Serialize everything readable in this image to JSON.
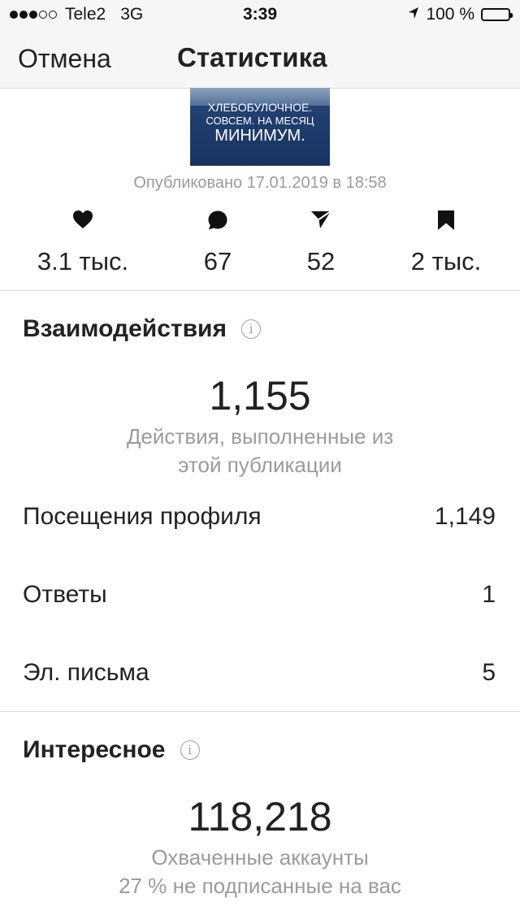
{
  "status_bar": {
    "carrier": "Tele2",
    "network": "3G",
    "time": "3:39",
    "battery": "100 %",
    "signal_bars_filled": 3,
    "signal_bars_total": 5
  },
  "nav": {
    "cancel_label": "Отмена",
    "title": "Статистика"
  },
  "post": {
    "caption_lines": [
      "ХЛЕБОБУЛОЧНОЕ.",
      "СОВСЕМ. НА МЕСЯЦ",
      "МИНИМУМ."
    ],
    "published": "Опубликовано 17.01.2019 в 18:58"
  },
  "counters": {
    "likes": "3.1 тыс.",
    "comments": "67",
    "shares": "52",
    "saves": "2 тыс."
  },
  "interactions": {
    "title": "Взаимодействия",
    "total": "1,155",
    "description_line1": "Действия, выполненные из",
    "description_line2": "этой публикации",
    "rows": [
      {
        "label": "Посещения профиля",
        "value": "1,149"
      },
      {
        "label": "Ответы",
        "value": "1"
      },
      {
        "label": "Эл. письма",
        "value": "5"
      }
    ]
  },
  "discovery": {
    "title": "Интересное",
    "total": "118,218",
    "description_line1": "Охваченные аккаунты",
    "description_line2": "27 % не подписанные на вас"
  },
  "icons": {
    "likes": "heart-icon",
    "comments": "comment-icon",
    "shares": "send-icon",
    "saves": "bookmark-icon",
    "info": "info-icon",
    "location": "location-arrow-icon"
  }
}
